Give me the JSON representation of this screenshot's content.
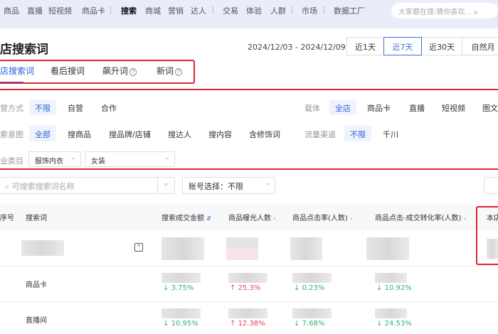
{
  "topnav": {
    "items": [
      "商品",
      "直播",
      "短视频",
      "商品卡",
      "搜索",
      "商城",
      "营销",
      "达人",
      "交易",
      "体验",
      "人群",
      "市场",
      "数据工厂"
    ],
    "active": "搜索",
    "search_placeholder": "大家都在搜:猜你喜欢..."
  },
  "page": {
    "title": "店搜索词",
    "date_range": "2024/12/03 - 2024/12/09",
    "ranges": [
      "近1天",
      "近7天",
      "近30天",
      "自然月"
    ],
    "active_range": "近7天"
  },
  "tabs": [
    {
      "label": "店搜索词",
      "active": true
    },
    {
      "label": "看后搜词"
    },
    {
      "label": "飙升词",
      "help": "?"
    },
    {
      "label": "新词",
      "help": "?"
    }
  ],
  "filters": {
    "operation": {
      "label": "营方式",
      "options": [
        "不限",
        "自营",
        "合作"
      ],
      "selected": "不限"
    },
    "carrier": {
      "label": "载体",
      "options": [
        "全店",
        "商品卡",
        "直播",
        "短视频",
        "图文"
      ],
      "selected": "全店"
    },
    "intent": {
      "label": "索意图",
      "options": [
        "全部",
        "搜商品",
        "搜品牌/店铺",
        "搜达人",
        "搜内容",
        "含修饰词"
      ],
      "selected": "全部"
    },
    "channel": {
      "label": "流量渠道",
      "options": [
        "不限",
        "千川"
      ],
      "selected": "不限"
    },
    "category": {
      "label": "业类目",
      "level1": "服饰内衣",
      "level2": "女装"
    }
  },
  "toolbar": {
    "search_placeholder": "可搜索搜索词名称",
    "account_select": "账号选择：不限"
  },
  "table": {
    "headers": [
      "序号",
      "搜索词",
      "搜索成交金额",
      "商品曝光人数",
      "商品点击率(人数)",
      "商品点击-成交转化率(人数)",
      "本店"
    ],
    "rows": [
      {
        "term": "",
        "changes": []
      },
      {
        "term": "商品卡",
        "changes": [
          {
            "dir": "down",
            "v": "3.75%"
          },
          {
            "dir": "up",
            "v": "25.3%"
          },
          {
            "dir": "down",
            "v": "0.23%"
          },
          {
            "dir": "down",
            "v": "10.92%"
          }
        ]
      },
      {
        "term": "直播间",
        "changes": [
          {
            "dir": "down",
            "v": "10.95%"
          },
          {
            "dir": "up",
            "v": "12.38%"
          },
          {
            "dir": "down",
            "v": "7.68%"
          },
          {
            "dir": "down",
            "v": "24.53%"
          }
        ]
      }
    ]
  },
  "colors": {
    "accent": "#2b62d9",
    "highlight": "#e0262d",
    "down": "#2fb07a",
    "up": "#e0455e"
  }
}
